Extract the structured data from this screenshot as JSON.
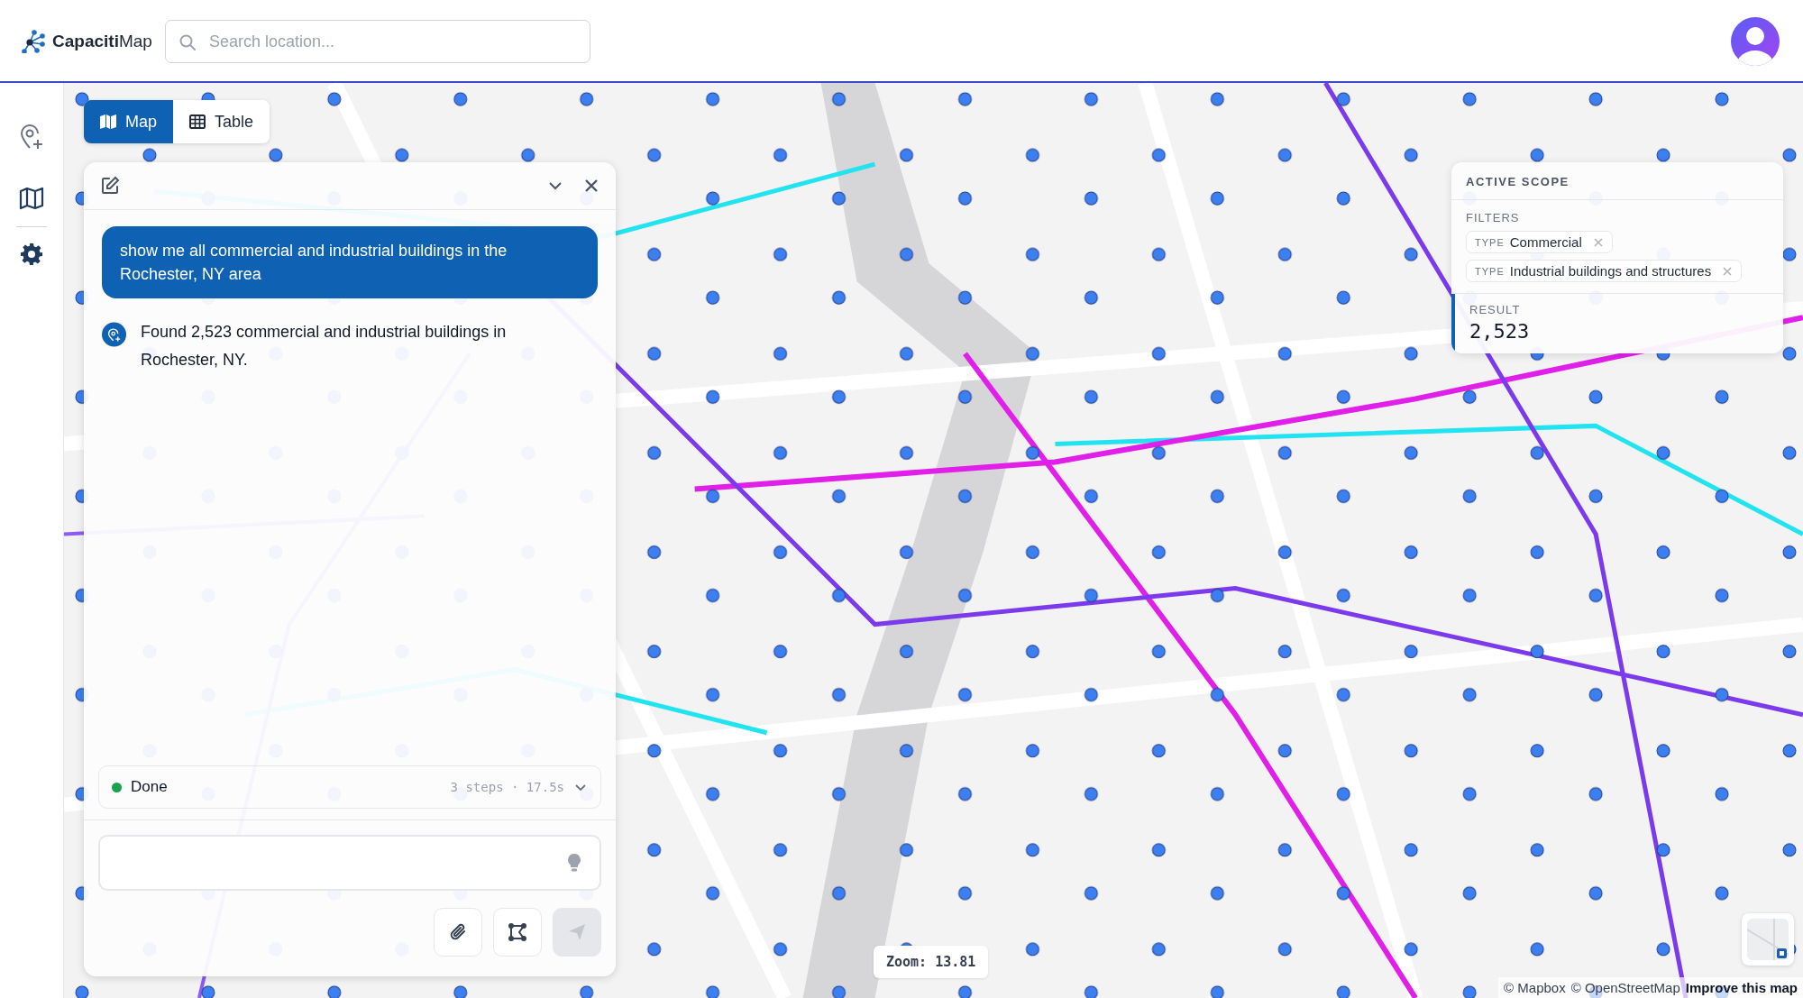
{
  "header": {
    "logo": "**Capaciti**Map",
    "search": {
      "placeholder": "Search location..."
    }
  },
  "view_toggle": [
    {
      "label": "Map",
      "selected": true
    },
    {
      "label": "Table",
      "selected": false
    }
  ],
  "chat": {
    "messages": [
      {
        "kind": "user",
        "text": "show me all commercial and industrial buildings in the Rochester, NY area"
      },
      {
        "kind": "assistant",
        "text": "Found 2,523 commercial and industrial buildings in Rochester, NY."
      }
    ],
    "status": {
      "label": "Done",
      "meta": "3 steps · 17.5s"
    }
  },
  "scope": {
    "title": "ACTIVE SCOPE",
    "filters_label": "FILTERS",
    "filters": [
      {
        "key": "TYPE",
        "value": "Commercial"
      },
      {
        "key": "TYPE",
        "value": "Industrial buildings and structures"
      }
    ],
    "result_label": "RESULT",
    "result": "2,523"
  },
  "map": {
    "zoom_label": "Zoom: 13.81",
    "attribution": [
      {
        "text": "© Mapbox",
        "strong": false
      },
      {
        "text": "© OpenStreetMap",
        "strong": false
      },
      {
        "text": "Improve this map",
        "strong": true
      }
    ]
  }
}
